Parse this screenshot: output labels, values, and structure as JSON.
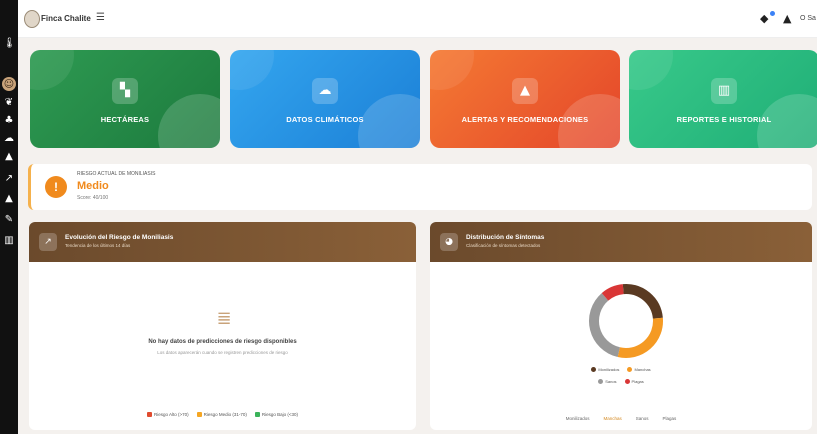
{
  "topbar": {
    "farm_name": "Finca Chalite",
    "menu_icon": "menu-icon",
    "user_text": "O Sa"
  },
  "sidebar": {
    "icons": [
      "thermometer-icon",
      "user-icon",
      "leaf-icon",
      "tree-icon",
      "cloud-icon",
      "warning-icon",
      "chart-icon",
      "bell-icon",
      "tools-icon",
      "bar-chart-icon"
    ]
  },
  "cards": [
    {
      "label": "HECTÁREAS",
      "icon": "map-icon",
      "color_from": "#2e9a52",
      "color_to": "#1c7a3d"
    },
    {
      "label": "DATOS CLIMÁTICOS",
      "icon": "cloud-icon",
      "color_from": "#34a6ef",
      "color_to": "#1b7fd6"
    },
    {
      "label": "ALERTAS Y RECOMENDACIONES",
      "icon": "bell-icon",
      "color_from": "#f47a33",
      "color_to": "#e4452a"
    },
    {
      "label": "REPORTES E HISTORIAL",
      "icon": "bar-chart-icon",
      "color_from": "#38c98a",
      "color_to": "#1fae76"
    }
  ],
  "risk": {
    "title": "RIESGO ACTUAL DE MONILIASIS",
    "level": "Medio",
    "score": "Score: 40/100"
  },
  "evolution": {
    "title": "Evolución del Riesgo de Moniliasis",
    "subtitle": "Tendencia de los últimos 14 días",
    "empty_title": "No hay datos de predicciones de riesgo disponibles",
    "empty_sub": "Los datos aparecerán cuando se registren predicciones de riesgo",
    "legend": [
      {
        "label": "Riesgo Alto (>70)",
        "color": "#e04b2f"
      },
      {
        "label": "Riesgo Medio (31-70)",
        "color": "#f5a623"
      },
      {
        "label": "Riesgo Bajo (<30)",
        "color": "#3bb35a"
      }
    ]
  },
  "distribution": {
    "title": "Distribución de Síntomas",
    "subtitle": "Clasificación de síntomas detectados",
    "legend_row1": [
      {
        "label": "Monilizados",
        "color": "#5a3a22"
      },
      {
        "label": "Manchas",
        "color": "#f59a23"
      }
    ],
    "legend_row2": [
      {
        "label": "Sanos",
        "color": "#999999"
      },
      {
        "label": "Plagas",
        "color": "#d93636"
      }
    ],
    "tabs": [
      "Monilizados",
      "Manchas",
      "Sanos",
      "Plagas"
    ],
    "active_tab": 1
  },
  "chart_data": {
    "type": "pie",
    "title": "Distribución de Síntomas",
    "categories": [
      "Monilizados",
      "Manchas",
      "Sanos",
      "Plagas"
    ],
    "values": [
      25,
      30,
      35,
      10
    ],
    "colors": [
      "#5a3a22",
      "#f59a23",
      "#999999",
      "#d93636"
    ]
  }
}
